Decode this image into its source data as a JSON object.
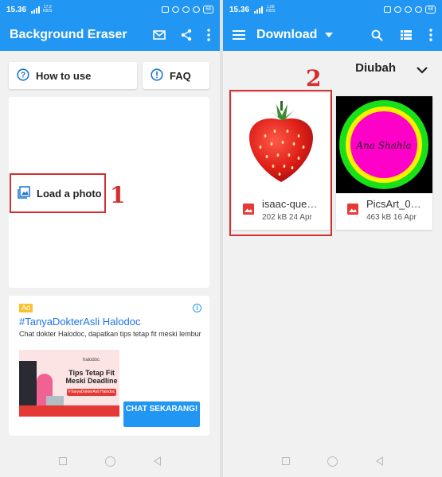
{
  "left": {
    "status": {
      "time": "15.36",
      "speed": "17.0\nKB/S",
      "battery": "68"
    },
    "appbar": {
      "title": "Background Eraser"
    },
    "buttons": {
      "how_to_use": "How to use",
      "faq": "FAQ",
      "load_photo": "Load a photo"
    },
    "annotation": "1",
    "ad": {
      "tag": "Ad",
      "info": "i",
      "title": "#TanyaDokterAsli Halodoc",
      "description": "Chat dokter Halodoc, dapatkan tips tetap fit meski lembur",
      "image_brand": "halodoc",
      "image_headline": "Tips Tetap Fit Meski Deadline",
      "image_pill": "#TanyaDokterAsli Halodoc",
      "cta": "CHAT SEKARANG!"
    }
  },
  "right": {
    "status": {
      "time": "15.36",
      "speed": "1.00\nKB/S",
      "battery": "68"
    },
    "appbar": {
      "title": "Download"
    },
    "sort": {
      "label": "Diubah"
    },
    "annotation": "2",
    "files": [
      {
        "name": "isaac-que…",
        "size": "202 kB",
        "date": "24 Apr"
      },
      {
        "name": "PicsArt_0…",
        "size": "463 kB",
        "date": "16 Apr"
      }
    ],
    "tile2_text": "Ana Shahla"
  },
  "colors": {
    "primary": "#2196f3",
    "annotation": "#d32f2f",
    "ad_tag": "#fbc02d"
  }
}
